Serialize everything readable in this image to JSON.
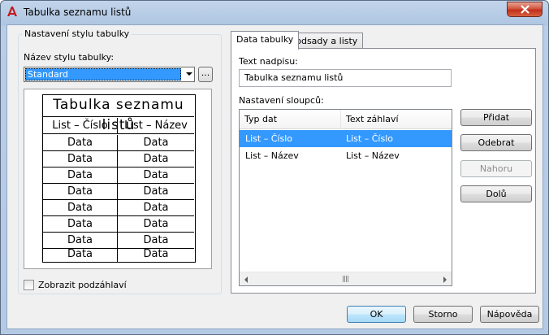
{
  "window": {
    "title": "Tabulka seznamu listů"
  },
  "left": {
    "group_title": "Nastavení stylu tabulky",
    "style_label": "Název stylu tabulky:",
    "style_value": "Standard",
    "browse_label": "...",
    "preview": {
      "title": "Tabulka seznamu listů",
      "headers": [
        "List – Číslo",
        "List – Název"
      ],
      "rows": [
        [
          "Data",
          "Data"
        ],
        [
          "Data",
          "Data"
        ],
        [
          "Data",
          "Data"
        ],
        [
          "Data",
          "Data"
        ],
        [
          "Data",
          "Data"
        ],
        [
          "Data",
          "Data"
        ],
        [
          "Data",
          "Data"
        ],
        [
          "Data",
          "Data"
        ]
      ]
    },
    "subheader_label": "Zobrazit podzáhlaví",
    "subheader_checked": false
  },
  "tabs": [
    {
      "label": "Data tabulky",
      "active": true
    },
    {
      "label": "Podsady a listy",
      "active": false
    }
  ],
  "data_tab": {
    "caption_label": "Text nadpisu:",
    "caption_value": "Tabulka seznamu listů",
    "columns_label": "Nastavení sloupců:",
    "columns_headers": [
      "Typ dat",
      "Text záhlaví"
    ],
    "columns_rows": [
      {
        "type": "List – Číslo",
        "header": "List – Číslo",
        "selected": true
      },
      {
        "type": "List – Název",
        "header": "List – Název",
        "selected": false
      }
    ],
    "buttons": {
      "add": "Přidat",
      "remove": "Odebrat",
      "up": "Nahoru",
      "down": "Dolů"
    }
  },
  "footer": {
    "ok": "OK",
    "cancel": "Storno",
    "help": "Nápověda"
  },
  "colors": {
    "selection": "#3399ff",
    "title_bar": "#b4c9e4",
    "close": "#c0301a"
  }
}
